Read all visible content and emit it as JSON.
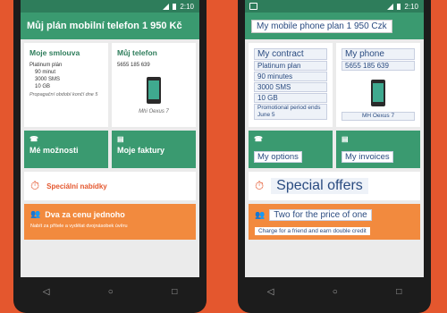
{
  "status_time": "2:10",
  "left": {
    "title": "Můj plán mobilní telefon 1 950 Kč",
    "contract": {
      "title": "Moje smlouva",
      "plan": "Platinum plán",
      "minutes": "90 minut",
      "sms": "3000 SMS",
      "data": "10 GB",
      "promo": "Propagační období končí dne 5"
    },
    "myphone": {
      "title": "Můj telefon",
      "number": "5655 185 639",
      "model": "Mhi Oexus 7"
    },
    "options_label": "Mé možnosti",
    "invoices_label": "Moje faktury",
    "special_label": "Speciální nabídky",
    "offer_title": "Dva za cenu jednoho",
    "offer_sub": "Nabít za přítele a vydělat dvojnásobek úvěru"
  },
  "right": {
    "title": "My mobile phone plan 1 950 Czk",
    "contract": {
      "title": "My contract",
      "plan": "Platinum plan",
      "minutes": "90 minutes",
      "sms": "3000 SMS",
      "data": "10 GB",
      "promo": "Promotional period ends June 5"
    },
    "myphone": {
      "title": "My phone",
      "number": "5655 185 639",
      "model": "MH Oexus 7"
    },
    "options_label": "My options",
    "invoices_label": "My invoices",
    "special_label": "Special offers",
    "offer_title": "Two for the price of one",
    "offer_sub": "Charge for a friend and earn double credit"
  },
  "icons": {
    "phone": "☎",
    "invoice": "▤",
    "clock": "⏱",
    "people": "👥",
    "back": "◁",
    "home": "○",
    "recent": "□"
  },
  "colors": {
    "background": "#e4572e",
    "primary": "#3a9a70",
    "offer": "#f28a3e"
  }
}
